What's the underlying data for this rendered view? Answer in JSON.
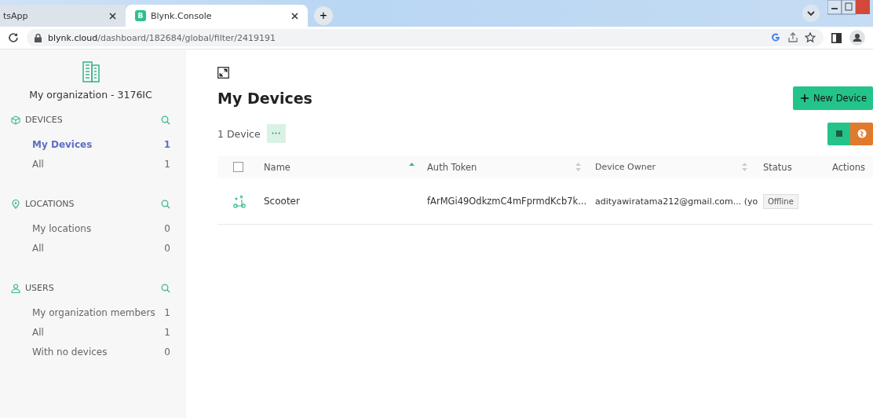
{
  "browser": {
    "tabs": [
      {
        "title": "tsApp",
        "selected": false
      },
      {
        "title": "Blynk.Console",
        "favicon": "B",
        "selected": true
      }
    ],
    "new_tab": "+",
    "address": {
      "host": "blynk.cloud",
      "path": "/dashboard/182684/global/filter/2419191"
    }
  },
  "sidebar": {
    "organization": "My organization - 3176IC",
    "sections": [
      {
        "kind": "devices",
        "title": "DEVICES",
        "items": [
          {
            "label": "My Devices",
            "count": "1",
            "selected": true
          },
          {
            "label": "All",
            "count": "1",
            "selected": false
          }
        ]
      },
      {
        "kind": "locations",
        "title": "LOCATIONS",
        "items": [
          {
            "label": "My locations",
            "count": "0",
            "selected": false
          },
          {
            "label": "All",
            "count": "0",
            "selected": false
          }
        ]
      },
      {
        "kind": "users",
        "title": "USERS",
        "items": [
          {
            "label": "My organization members",
            "count": "1",
            "selected": false
          },
          {
            "label": "All",
            "count": "1",
            "selected": false
          },
          {
            "label": "With no devices",
            "count": "0",
            "selected": false
          }
        ]
      }
    ]
  },
  "page": {
    "title": "My Devices",
    "new_button": "New Device",
    "device_count": "1 Device",
    "more": "•••"
  },
  "table": {
    "select_all_checked": false,
    "columns": [
      {
        "label": "Name",
        "sorted": true
      },
      {
        "label": "Auth Token",
        "sorted": false
      },
      {
        "label": "Device Owner",
        "sorted": false
      },
      {
        "label": "Status"
      },
      {
        "label": "Actions"
      }
    ],
    "rows": [
      {
        "name": "Scooter",
        "token": "fArMGi49OdkzmC4mFprmdKcb7k...",
        "owner": "adityawiratama212@gmail.com... (yo",
        "status": "Offline"
      }
    ]
  }
}
